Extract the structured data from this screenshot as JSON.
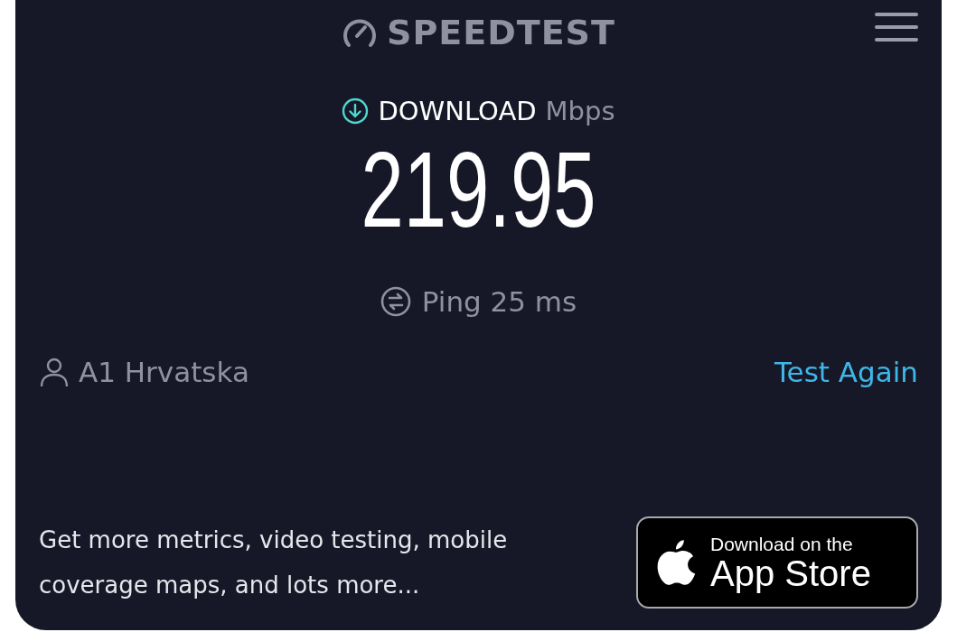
{
  "header": {
    "logo": "SPEEDTEST"
  },
  "result": {
    "label": "DOWNLOAD",
    "unit": "Mbps",
    "value": "219.95"
  },
  "ping": {
    "label": "Ping 25 ms"
  },
  "provider": {
    "name": "A1 Hrvatska"
  },
  "test_again": "Test Again",
  "promo": {
    "text": "Get more metrics, video testing, mobile coverage maps, and lots more...",
    "badge_small": "Download on the",
    "badge_large": "App Store"
  }
}
